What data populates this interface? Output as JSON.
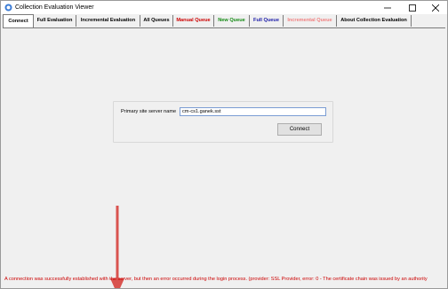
{
  "window": {
    "title": "Collection Evaluation Viewer"
  },
  "tabs": [
    {
      "label": "Connect",
      "color": "#000000"
    },
    {
      "label": "Full Evaluation",
      "color": "#000000"
    },
    {
      "label": "Incremental Evaluation",
      "color": "#000000"
    },
    {
      "label": "All Queues",
      "color": "#000000"
    },
    {
      "label": "Manual Queue",
      "color": "#cc0000"
    },
    {
      "label": "New Queue",
      "color": "#138a13"
    },
    {
      "label": "Full Queue",
      "color": "#1a1aa8"
    },
    {
      "label": "Incremental Queue",
      "color": "#f08080"
    },
    {
      "label": "About Collection Evaluation",
      "color": "#000000"
    }
  ],
  "connect": {
    "server_label": "Primary site server name",
    "server_value": "cm-cs1.ganek.sst",
    "connect_button": "Connect"
  },
  "status": {
    "message": "A connection was successfully established with the server, but then an error occurred during the login process. (provider: SSL Provider, error: 0 - The certificate chain was issued by an authority",
    "color": "#cc0000"
  },
  "annotation": {
    "arrow_color": "#d9534f"
  }
}
